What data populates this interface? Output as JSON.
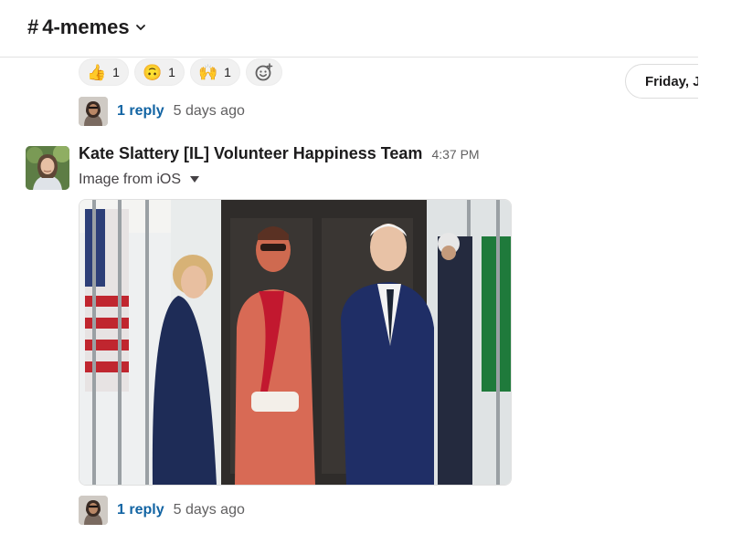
{
  "header": {
    "hash": "#",
    "channel_name": "4-memes",
    "icons": {
      "dropdown": "chevron-down-icon"
    }
  },
  "reactions": [
    {
      "emoji": "👍",
      "icon": "thumbs-up-emoji",
      "count": "1"
    },
    {
      "emoji": "🙃",
      "icon": "upside-down-face-emoji",
      "count": "1"
    },
    {
      "emoji": "🙌",
      "icon": "raised-hands-emoji",
      "count": "1"
    }
  ],
  "add_reaction_icon": "add-reaction-icon",
  "date_divider": "Friday, J",
  "thread_top": {
    "reply_label": "1 reply",
    "time": "5 days ago"
  },
  "message": {
    "sender": "Kate Slattery [IL] Volunteer Happiness Team",
    "timestamp": "4:37 PM",
    "file_label": "Image from iOS",
    "image_description": "photo of three people posing outside a white house entrance with flags and a guard"
  },
  "thread_bottom": {
    "reply_label": "1 reply",
    "time": "5 days ago"
  },
  "colors": {
    "link": "#1264a3",
    "muted": "#616061",
    "text": "#1d1c1d"
  }
}
